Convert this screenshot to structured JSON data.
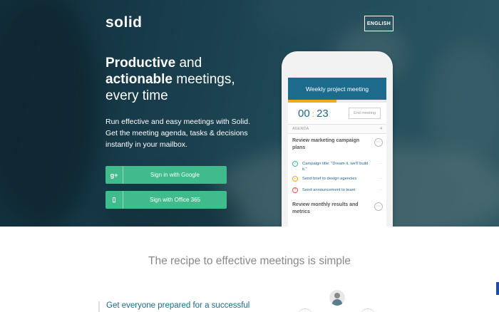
{
  "header": {
    "logo": "solid",
    "language_button": "ENGLISH"
  },
  "hero": {
    "headline_line1_bold": "Productive",
    "headline_line1_rest": " and",
    "headline_line2_bold": "actionable",
    "headline_line2_rest": " meetings,",
    "headline_line3": "every time",
    "subtext": "Run effective and easy meetings with Solid. Get the meeting agenda, tasks & decisions instantly in your mailbox.",
    "google_button": "Sign in with Google",
    "google_icon_glyph": "g+",
    "office_button": "Sign with Office 365",
    "office_icon_glyph": "▯"
  },
  "phone": {
    "meeting_title": "Weekly project meeting",
    "timer_minutes": "00",
    "timer_seconds": "23",
    "end_button": "End meeting",
    "agenda_label": "AGENDA",
    "agenda_count": "4",
    "item1_title": "Review marketing campaign plans",
    "tasks": [
      {
        "text": "Campaign title: \"Dream it, we'll build it.\"",
        "status": "done",
        "glyph": "✓"
      },
      {
        "text": "Send brief to design agencies",
        "status": "pending",
        "glyph": "•"
      },
      {
        "text": "Send announcement to team",
        "status": "question",
        "glyph": "?"
      }
    ],
    "item2_title": "Review monthly results and metrics",
    "more_glyph": "···"
  },
  "lower": {
    "recipe_heading": "The recipe to effective meetings is simple",
    "feature_heading": "Get everyone prepared for a successful"
  },
  "colors": {
    "accent_green": "#3fbb8c",
    "brand_blue": "#1c6a8c",
    "timer_orange": "#f5a623"
  }
}
